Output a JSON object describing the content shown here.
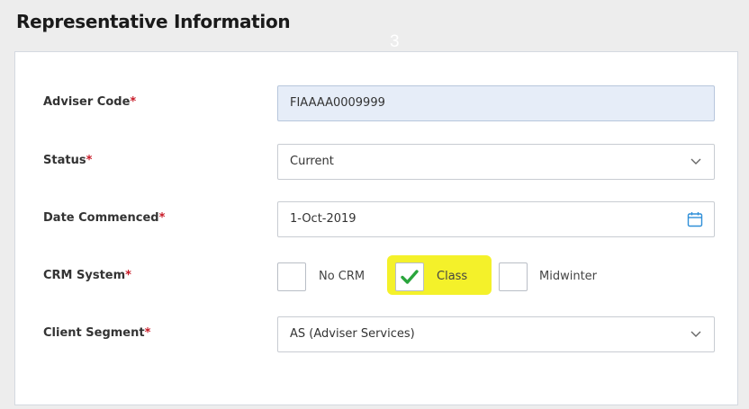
{
  "section": {
    "title": "Representative Information",
    "marker": "3"
  },
  "required_marker": "*",
  "form": {
    "adviser_code": {
      "label": "Adviser Code",
      "value": "FIAAAA0009999"
    },
    "status": {
      "label": "Status",
      "value": "Current"
    },
    "date_commenced": {
      "label": "Date Commenced",
      "value": "1-Oct-2019"
    },
    "crm_system": {
      "label": "CRM System",
      "options": [
        {
          "label": "No CRM",
          "checked": false
        },
        {
          "label": "Class",
          "checked": true,
          "highlighted": true
        },
        {
          "label": "Midwinter",
          "checked": false
        }
      ]
    },
    "client_segment": {
      "label": "Client Segment",
      "value": "AS (Adviser Services)"
    }
  },
  "colors": {
    "required": "#c81a27",
    "checkmark": "#2aa53c",
    "highlight": "#f4f12a",
    "readonly_bg": "#e6edf8",
    "calendar_icon": "#2f8fd8"
  },
  "icons": {
    "dropdown": "chevron-down-icon",
    "date": "calendar-icon",
    "checked": "checkmark-icon"
  }
}
